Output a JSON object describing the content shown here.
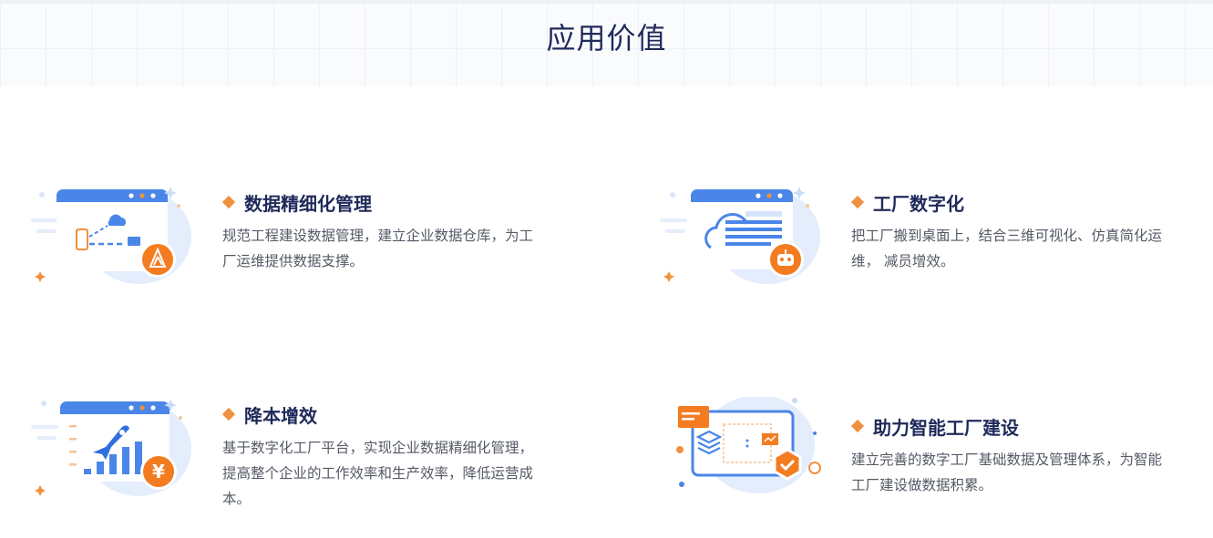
{
  "header": {
    "title": "应用价值"
  },
  "cards": [
    {
      "title": "数据精细化管理",
      "desc": "规范工程建设数据管理，建立企业数据仓库，为工厂运维提供数据支撑。",
      "icon": "data-management-icon"
    },
    {
      "title": "工厂数字化",
      "desc": "把工厂搬到桌面上，结合三维可视化、仿真简化运维， 减员增效。",
      "icon": "cloud-robot-icon"
    },
    {
      "title": "降本增效",
      "desc": "基于数字化工厂平台，实现企业数据精细化管理，提高整个企业的工作效率和生产效率，降低运营成本。",
      "icon": "rocket-growth-icon"
    },
    {
      "title": "助力智能工厂建设",
      "desc": "建立完善的数字工厂基础数据及管理体系，为智能工厂建设做数据积累。",
      "icon": "layers-check-icon"
    }
  ],
  "colors": {
    "accent": "#f0913f",
    "blue": "#4a86e8",
    "title": "#1f2a5a"
  }
}
